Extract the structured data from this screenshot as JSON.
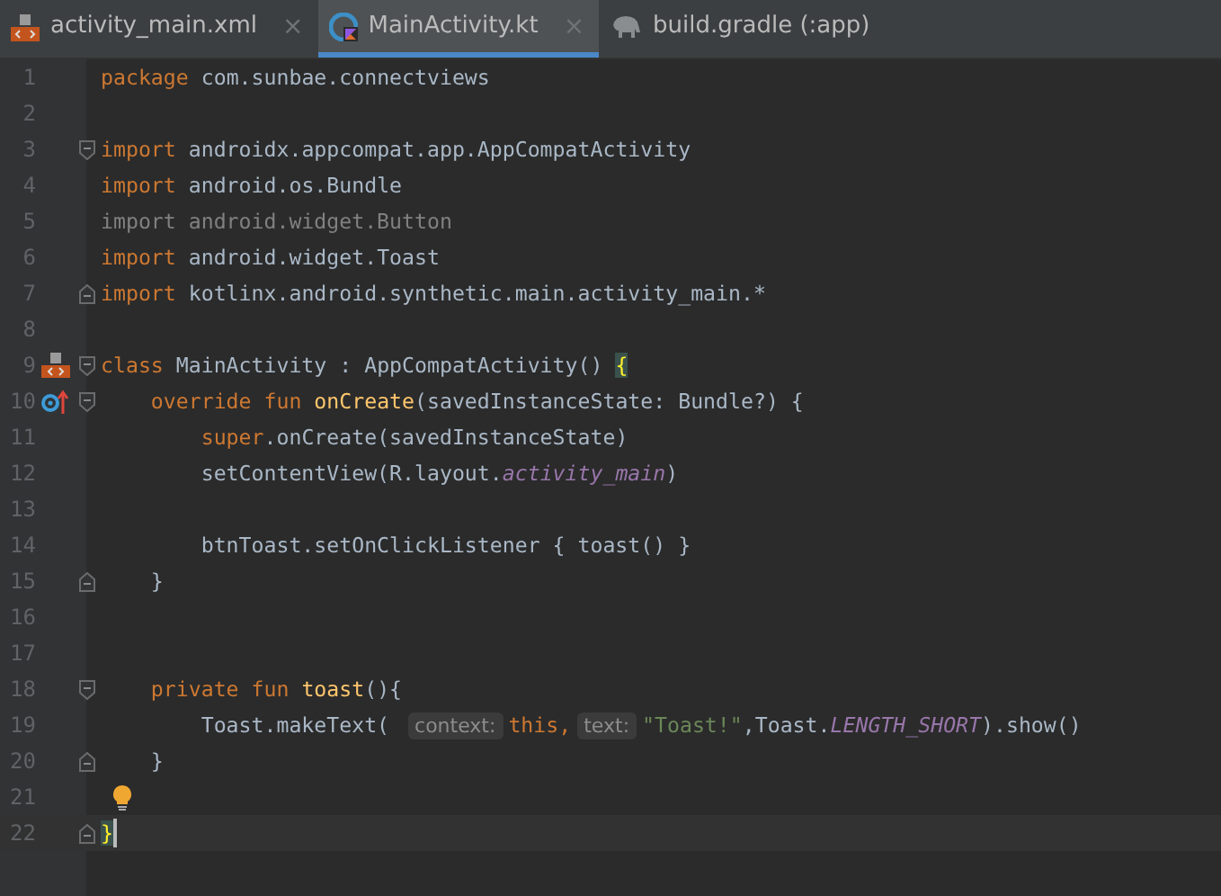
{
  "tabs": [
    {
      "label": "activity_main.xml",
      "kind": "xml",
      "selected": false,
      "closable": true
    },
    {
      "label": "MainActivity.kt",
      "kind": "kotlin",
      "selected": true,
      "closable": true
    },
    {
      "label": "build.gradle (:app)",
      "kind": "gradle",
      "selected": false,
      "closable": false
    }
  ],
  "close_glyph": "×",
  "lines": [
    {
      "number": "1",
      "tokens": [
        {
          "kind": "keyword",
          "text": "package"
        },
        {
          "kind": "plain",
          "text": " com.sunbae.connectviews"
        }
      ]
    },
    {
      "number": "2"
    },
    {
      "number": "3",
      "fold": {
        "kind": "start"
      },
      "tokens": [
        {
          "kind": "keyword",
          "text": "import"
        },
        {
          "kind": "plain",
          "text": " androidx.appcompat.app.AppCompatActivity"
        }
      ]
    },
    {
      "number": "4",
      "tokens": [
        {
          "kind": "keyword",
          "text": "import"
        },
        {
          "kind": "plain",
          "text": " android.os.Bundle"
        }
      ]
    },
    {
      "number": "5",
      "tokens": [
        {
          "kind": "unused",
          "text": "import android.widget.Button"
        }
      ]
    },
    {
      "number": "6",
      "tokens": [
        {
          "kind": "keyword",
          "text": "import"
        },
        {
          "kind": "plain",
          "text": " android.widget.Toast"
        }
      ]
    },
    {
      "number": "7",
      "fold": {
        "kind": "end"
      },
      "tokens": [
        {
          "kind": "keyword",
          "text": "import"
        },
        {
          "kind": "plain",
          "text": " kotlinx.android.synthetic.main.activity_main.*"
        }
      ]
    },
    {
      "number": "8"
    },
    {
      "number": "9",
      "gutter_icon": {
        "kind": "layout"
      },
      "fold": {
        "kind": "start"
      },
      "tokens": [
        {
          "kind": "keyword",
          "text": "class"
        },
        {
          "kind": "plain",
          "text": " MainActivity : AppCompatActivity() "
        },
        {
          "kind": "brace_match",
          "text": "{"
        }
      ]
    },
    {
      "number": "10",
      "gutter_icon": {
        "kind": "override"
      },
      "fold": {
        "kind": "start"
      },
      "tokens": [
        {
          "kind": "keyword",
          "text": "    override fun "
        },
        {
          "kind": "function",
          "text": "onCreate"
        },
        {
          "kind": "plain",
          "text": "(savedInstanceState: Bundle?) {"
        }
      ]
    },
    {
      "number": "11",
      "tokens": [
        {
          "kind": "keyword",
          "text": "        super"
        },
        {
          "kind": "plain",
          "text": ".onCreate(savedInstanceState)"
        }
      ]
    },
    {
      "number": "12",
      "tokens": [
        {
          "kind": "plain",
          "text": "        setContentView(R.layout."
        },
        {
          "kind": "constant",
          "text": "activity_main"
        },
        {
          "kind": "plain",
          "text": ")"
        }
      ]
    },
    {
      "number": "13"
    },
    {
      "number": "14",
      "tokens": [
        {
          "kind": "plain",
          "text": "        btnToast.setOnClickListener { toast() }"
        }
      ]
    },
    {
      "number": "15",
      "fold": {
        "kind": "end"
      },
      "tokens": [
        {
          "kind": "plain",
          "text": "    }"
        }
      ]
    },
    {
      "number": "16"
    },
    {
      "number": "17"
    },
    {
      "number": "18",
      "fold": {
        "kind": "start"
      },
      "tokens": [
        {
          "kind": "keyword",
          "text": "    private fun "
        },
        {
          "kind": "function",
          "text": "toast"
        },
        {
          "kind": "plain",
          "text": "(){"
        }
      ]
    },
    {
      "number": "19",
      "tokens": [
        {
          "kind": "plain",
          "text": "        Toast.makeText( "
        },
        {
          "kind": "hint",
          "text": "context:"
        },
        {
          "kind": "keyword",
          "text": "this,"
        },
        {
          "kind": "hint",
          "text": "text:"
        },
        {
          "kind": "string",
          "text": "\"Toast!\""
        },
        {
          "kind": "plain",
          "text": ",Toast."
        },
        {
          "kind": "constant",
          "text": "LENGTH_SHORT"
        },
        {
          "kind": "plain",
          "text": ").show()"
        }
      ]
    },
    {
      "number": "20",
      "fold": {
        "kind": "end"
      },
      "tokens": [
        {
          "kind": "plain",
          "text": "    }"
        }
      ]
    },
    {
      "number": "21",
      "intention": true
    },
    {
      "number": "22",
      "current": true,
      "fold": {
        "kind": "end"
      },
      "tokens": [
        {
          "kind": "brace_match",
          "text": "}"
        }
      ]
    }
  ]
}
